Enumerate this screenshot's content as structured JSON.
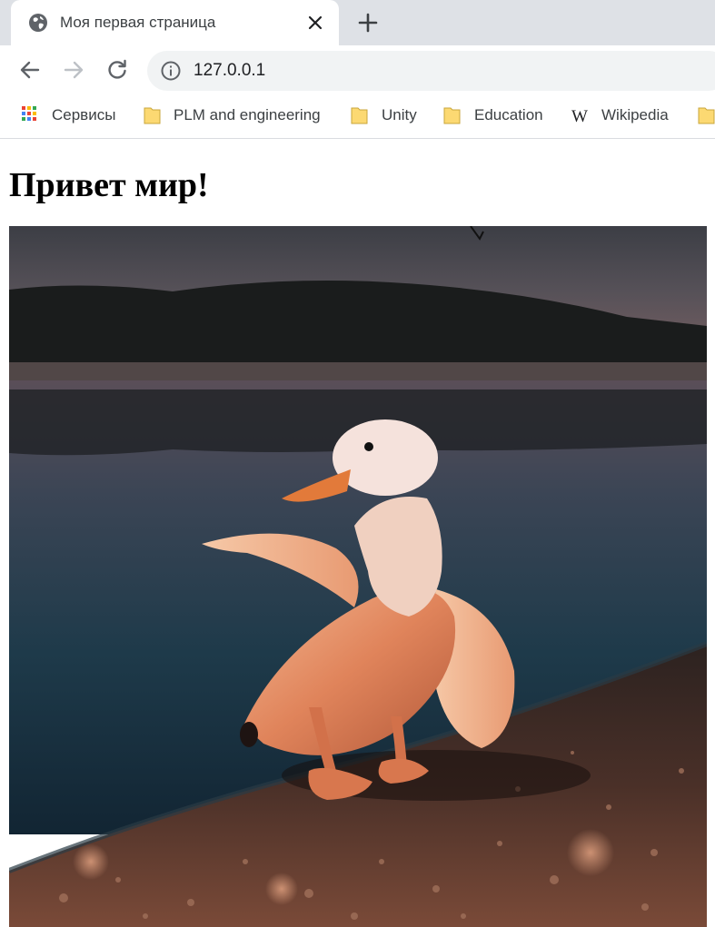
{
  "tab": {
    "title": "Моя первая страница",
    "favicon_icon": "globe-icon",
    "close_icon": "close-icon"
  },
  "new_tab_icon": "plus-icon",
  "toolbar": {
    "back_icon": "arrow-left-icon",
    "forward_icon": "arrow-right-icon",
    "reload_icon": "reload-icon",
    "site_info_icon": "info-icon",
    "url": "127.0.0.1"
  },
  "bookmarks": [
    {
      "label": "Сервисы",
      "icon": "apps-grid-icon"
    },
    {
      "label": "PLM and engineering",
      "icon": "folder-icon"
    },
    {
      "label": "Unity",
      "icon": "folder-icon"
    },
    {
      "label": "Education",
      "icon": "folder-icon"
    },
    {
      "label": "Wikipedia",
      "icon": "wikipedia-icon"
    },
    {
      "label": "",
      "icon": "folder-icon"
    }
  ],
  "page": {
    "heading": "Привет мир!",
    "image_subject": "duck made of a peeled banana standing on a lakeshore at dusk"
  },
  "colors": {
    "tabstrip": "#dee1e6",
    "omnibox": "#f1f3f4",
    "folder": "#fcd972",
    "text": "#3c4043"
  }
}
